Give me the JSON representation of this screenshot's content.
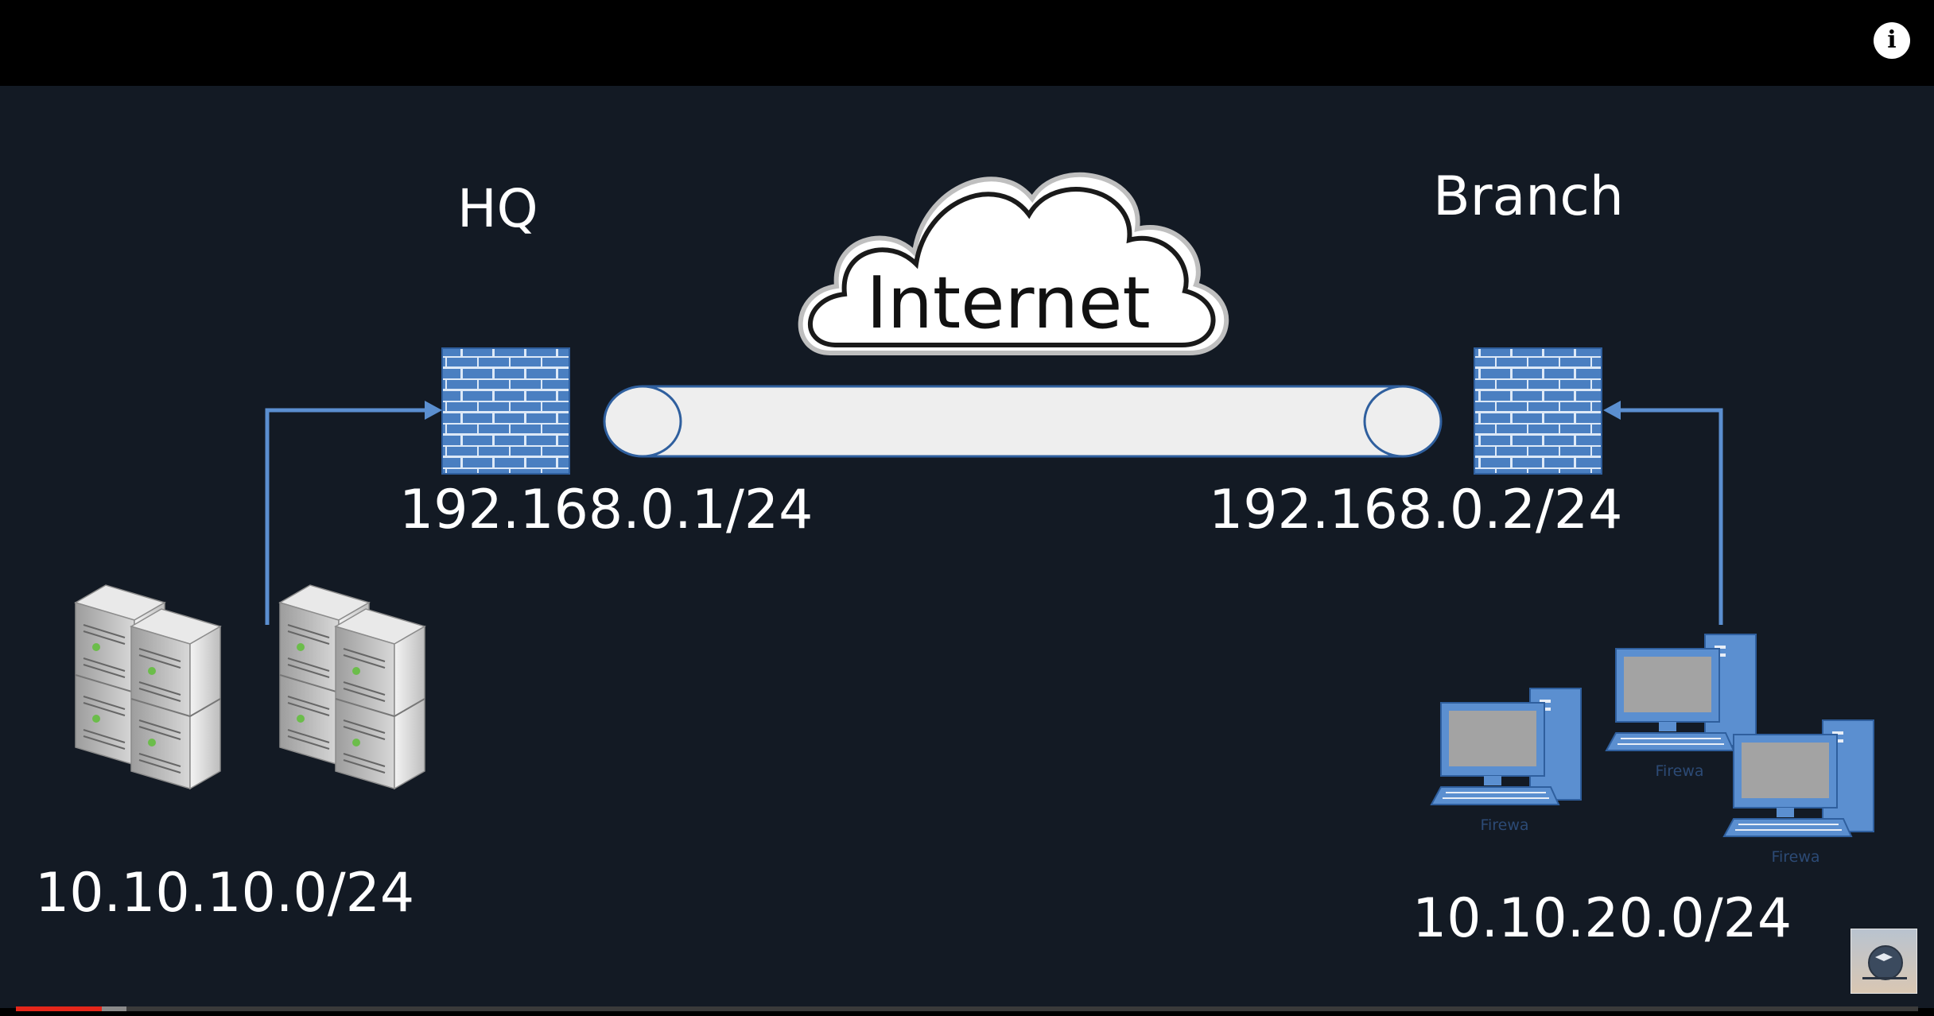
{
  "diagram": {
    "hq_label": "HQ",
    "branch_label": "Branch",
    "cloud_label": "Internet",
    "hq_firewall_ip": "192.168.0.1/24",
    "branch_firewall_ip": "192.168.0.2/24",
    "hq_subnet": "10.10.10.0/24",
    "branch_subnet": "10.10.20.0/24",
    "pc_captions": [
      "Firewa",
      "Firewa",
      "Firewa"
    ]
  },
  "player": {
    "info_icon_glyph": "i",
    "played_fraction": 0.045,
    "buffered_fraction": 0.058
  },
  "colors": {
    "slide_background": "#131a24",
    "firewall_blue": "#4a7fc1",
    "arrow_blue": "#5b8fd0",
    "progress_red": "#e5261a"
  }
}
